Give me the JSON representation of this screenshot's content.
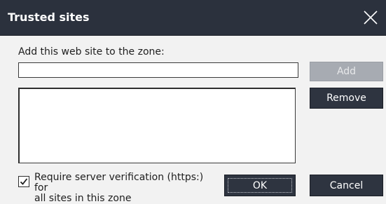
{
  "window": {
    "title": "Trusted sites",
    "close_icon": "close-icon"
  },
  "form": {
    "prompt": "Add this web site to the zone:",
    "url_value": "",
    "url_placeholder": "",
    "sites": []
  },
  "buttons": {
    "add": "Add",
    "add_enabled": false,
    "remove": "Remove",
    "ok": "OK",
    "cancel": "Cancel"
  },
  "option": {
    "checked": true,
    "label_line1": "Require server verification (https:) for",
    "label_line2": "all sites in this zone"
  },
  "colors": {
    "titlebar": "#2b313d",
    "button": "#2e3440",
    "button_disabled": "#a7abb2",
    "background": "#f2f2f2"
  }
}
